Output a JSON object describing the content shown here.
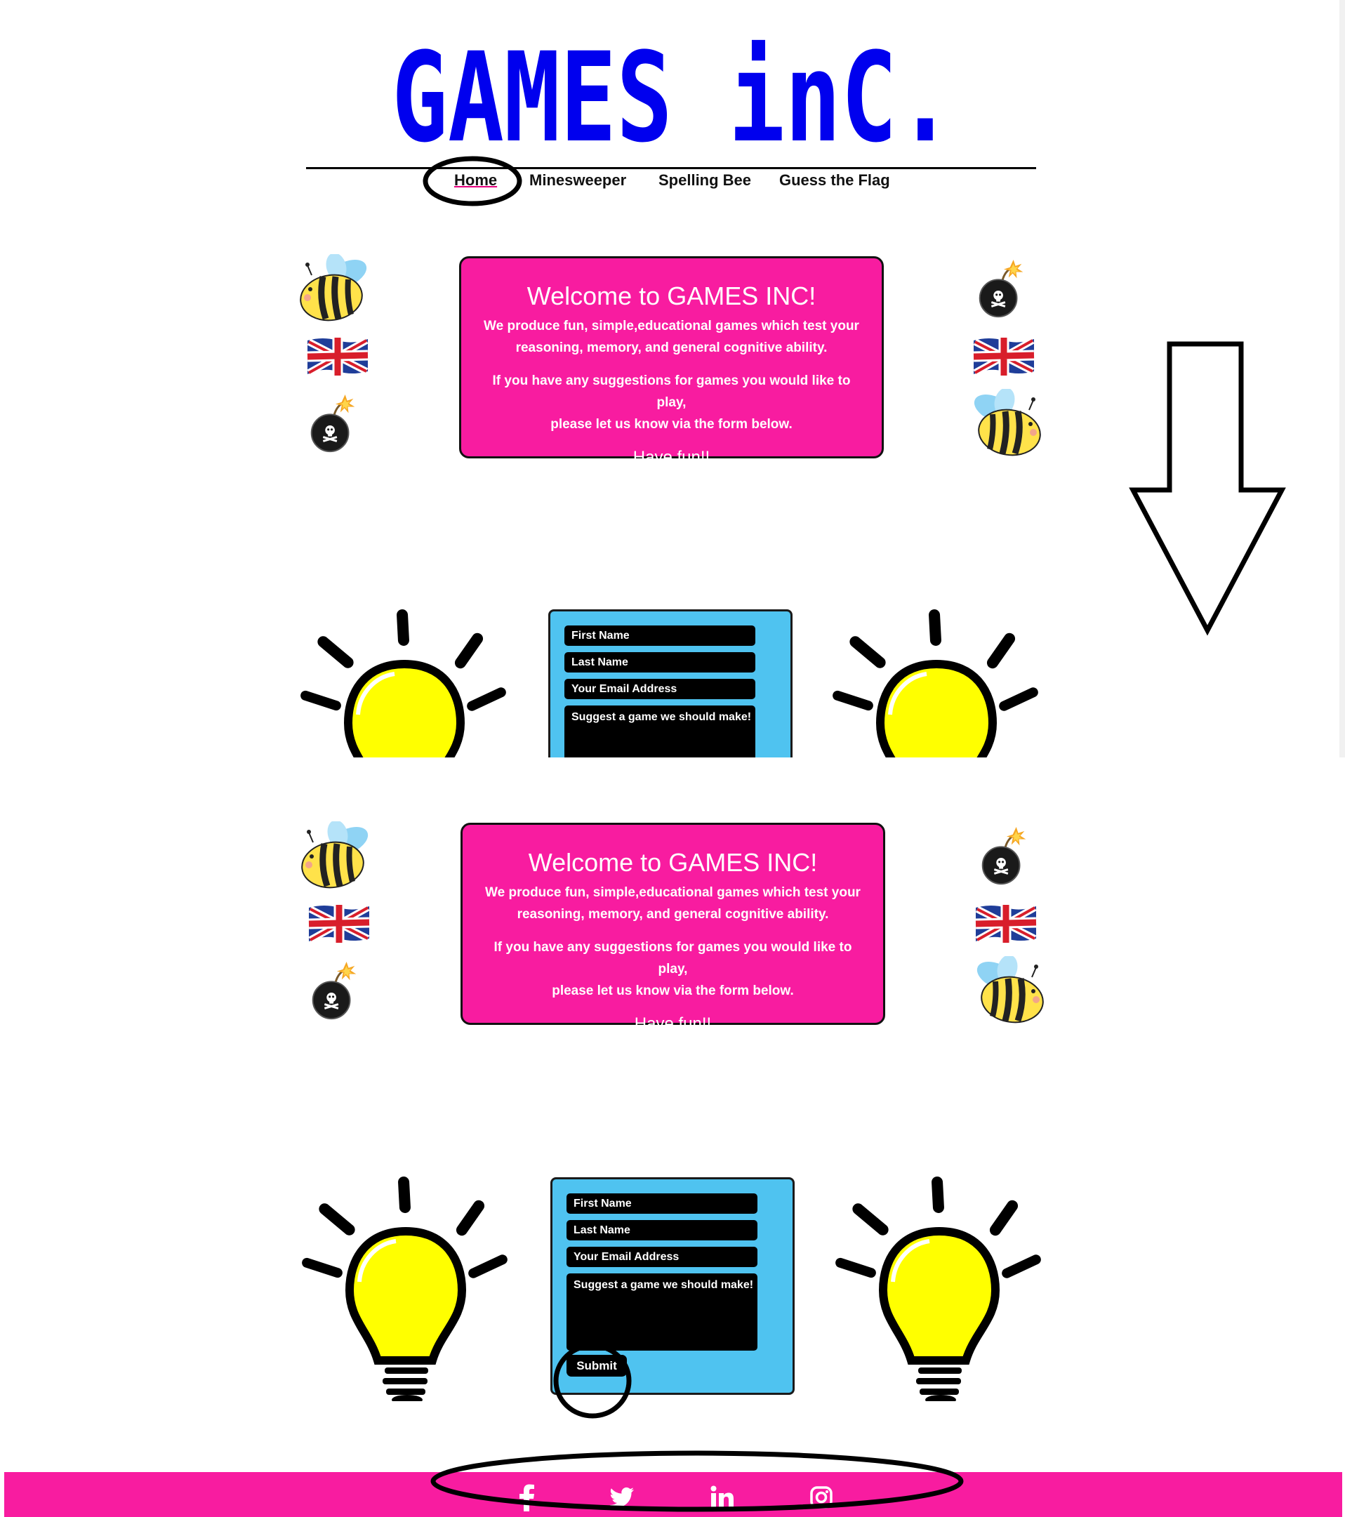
{
  "site": {
    "logo_text": "GAMES inC."
  },
  "nav": {
    "items": [
      {
        "label": "Home",
        "active": true
      },
      {
        "label": "Minesweeper",
        "active": false
      },
      {
        "label": "Spelling Bee",
        "active": false
      },
      {
        "label": "Guess the Flag",
        "active": false
      }
    ]
  },
  "welcome": {
    "heading": "Welcome to GAMES INC!",
    "paragraph1_line1": "We produce fun, simple,educational games which test your",
    "paragraph1_line2": "reasoning, memory, and general cognitive ability.",
    "paragraph2_line1": "If you have any suggestions for games you would like to play,",
    "paragraph2_line2": "please let us know via the form below.",
    "closing": "Have fun!!"
  },
  "form": {
    "first_name_placeholder": "First Name",
    "last_name_placeholder": "Last Name",
    "email_placeholder": "Your Email Address",
    "suggestion_placeholder": "Suggest a game we should make!",
    "submit_label": "Submit"
  },
  "footer": {
    "social_icons": [
      "facebook-icon",
      "twitter-icon",
      "linkedin-icon",
      "instagram-icon"
    ]
  },
  "colors": {
    "logo_blue": "#0000ee",
    "accent_pink": "#f81ca0",
    "form_blue": "#4fc3f0",
    "bulb_yellow": "#ffff00"
  },
  "icons": [
    "bee-icon",
    "union-jack-flag-icon",
    "bomb-icon",
    "lightbulb-icon",
    "down-arrow-annotation"
  ]
}
